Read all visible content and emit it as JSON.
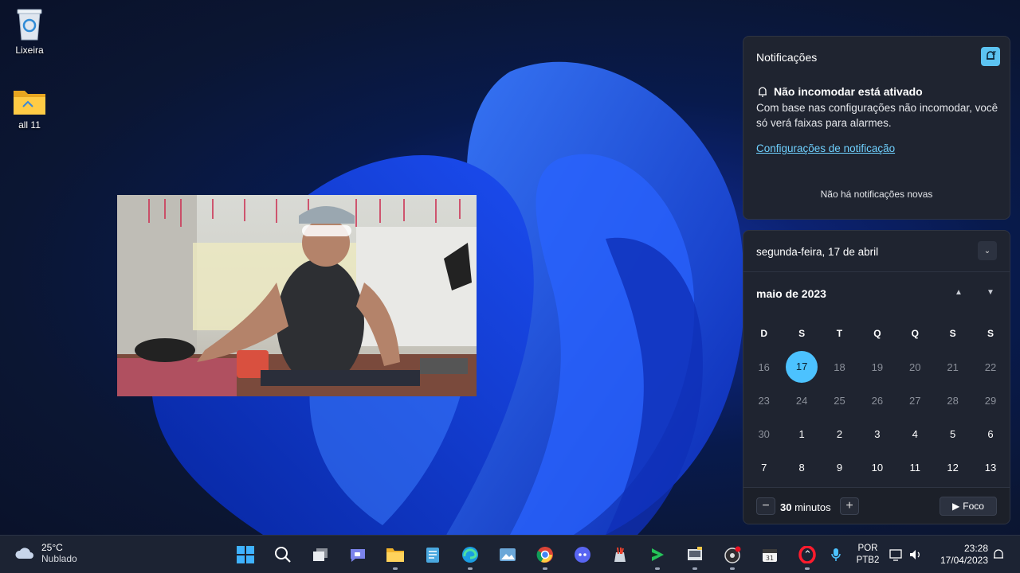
{
  "desktop": {
    "icons": [
      {
        "label": "Lixeira",
        "icon": "recycle-bin-icon"
      },
      {
        "label": "all 11",
        "icon": "folder-icon"
      }
    ]
  },
  "notifications": {
    "title": "Notificações",
    "dnd_title": "Não incomodar está ativado",
    "dnd_body": "Com base nas configurações não incomodar, você só verá faixas para alarmes.",
    "settings_link": "Configurações de notificação",
    "empty_text": "Não há notificações novas"
  },
  "calendar": {
    "full_date": "segunda-feira, 17 de abril",
    "month_label": "maio de 2023",
    "weekdays": [
      "D",
      "S",
      "T",
      "Q",
      "Q",
      "S",
      "S"
    ],
    "weeks": [
      [
        "16",
        "17",
        "18",
        "19",
        "20",
        "21",
        "22"
      ],
      [
        "23",
        "24",
        "25",
        "26",
        "27",
        "28",
        "29"
      ],
      [
        "30",
        "1",
        "2",
        "3",
        "4",
        "5",
        "6"
      ],
      [
        "7",
        "8",
        "9",
        "10",
        "11",
        "12",
        "13"
      ]
    ],
    "today": "17",
    "focus": {
      "minus": "−",
      "value": "30",
      "unit": "minutos",
      "plus": "+",
      "button": "Foco"
    }
  },
  "taskbar": {
    "weather": {
      "temp": "25°C",
      "condition": "Nublado"
    },
    "apps": [
      "windows-start-icon",
      "search-icon",
      "task-view-icon",
      "chat-icon",
      "file-explorer-icon",
      "notepad-icon",
      "edge-icon",
      "photos-icon",
      "chrome-icon",
      "discord-icon",
      "paint-icon",
      "media-player-icon",
      "terminal-icon",
      "obs-icon",
      "calendar-app-icon",
      "opera-icon"
    ],
    "language": {
      "line1": "POR",
      "line2": "PTB2"
    },
    "time": "23:28",
    "date": "17/04/2023"
  },
  "colors": {
    "accent": "#4cc2ff",
    "panel": "#1f2430",
    "taskbar": "#1c2333"
  }
}
